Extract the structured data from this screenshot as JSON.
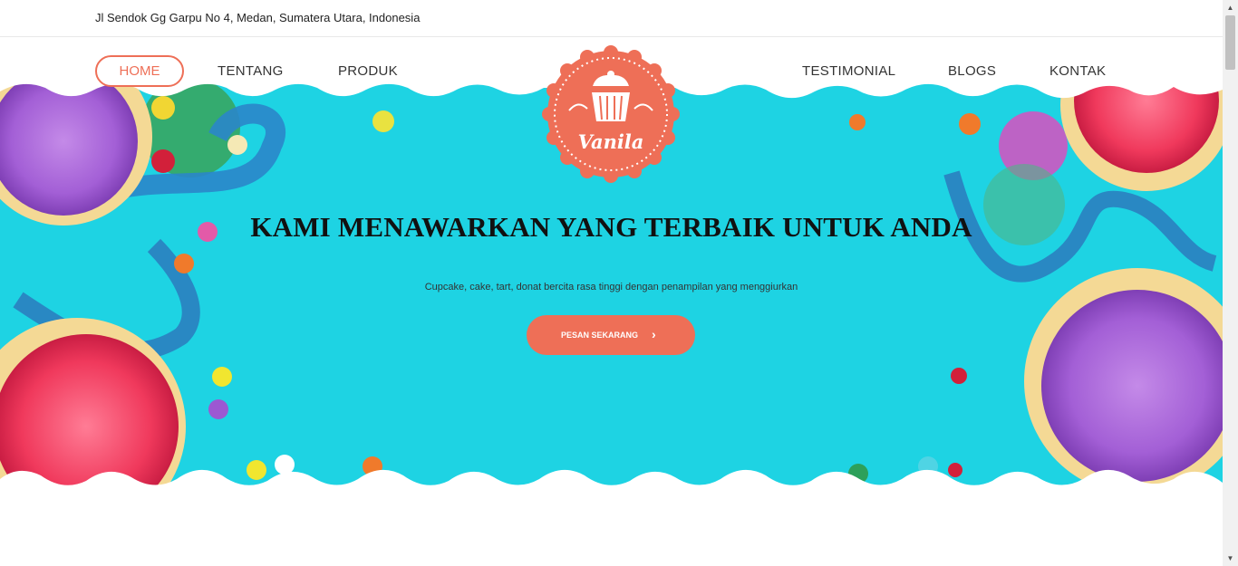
{
  "topbar": {
    "address": "Jl Sendok Gg Garpu No 4, Medan, Sumatera Utara, Indonesia"
  },
  "nav": {
    "home": "HOME",
    "about": "TENTANG",
    "products": "PRODUK",
    "testimonial": "TESTIMONIAL",
    "blogs": "BLOGS",
    "contact": "KONTAK"
  },
  "logo": {
    "name": "Vanila",
    "icon": "cupcake-icon"
  },
  "hero": {
    "headline": "KAMI MENAWARKAN YANG TERBAIK UNTUK ANDA",
    "subline": "Cupcake, cake, tart, donat bercita rasa tinggi dengan penampilan yang menggiurkan",
    "cta_label": "PESAN SEKARANG",
    "cta_icon": "chevron-right-icon"
  },
  "colors": {
    "accent": "#ee6f57",
    "hero_bg": "#1ed3e3",
    "purple_frosting": "#a35fd6",
    "pink_frosting": "#f0395c"
  }
}
